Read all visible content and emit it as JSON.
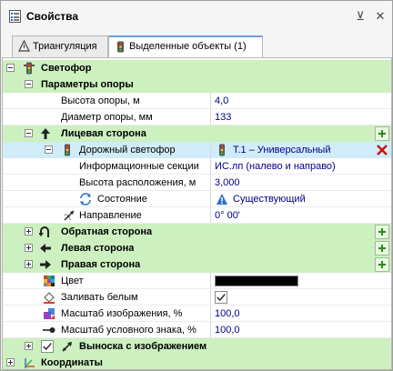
{
  "window": {
    "title": "Свойства",
    "pin_glyph": "⊻",
    "close_glyph": "✕"
  },
  "tabs": [
    {
      "label": "Триангуляция",
      "icon": "triangle-icon",
      "active": false
    },
    {
      "label": "Выделенные объекты (1)",
      "icon": "traffic-light-icon",
      "active": true
    }
  ],
  "grid": {
    "root": {
      "label": "Светофор"
    },
    "support_params": {
      "label": "Параметры опоры",
      "height_label": "Высота опоры, м",
      "height_value": "4,0",
      "diameter_label": "Диаметр опоры, мм",
      "diameter_value": "133"
    },
    "front_side": {
      "label": "Лицевая сторона",
      "road_light_label": "Дорожный светофор",
      "road_light_value": "Т.1 – Универсальный",
      "info_sections_label": "Информационные секции",
      "info_sections_value": "ИС.лп (налево и направо)",
      "placement_height_label": "Высота расположения, м",
      "placement_height_value": "3,000",
      "state_label": "Состояние",
      "state_value": "Существующий",
      "direction_label": "Направление",
      "direction_value": "0° 00'"
    },
    "back_side": {
      "label": "Обратная сторона"
    },
    "left_side": {
      "label": "Левая сторона"
    },
    "right_side": {
      "label": "Правая сторона"
    },
    "color": {
      "label": "Цвет",
      "value_hex": "#000000"
    },
    "fill_white": {
      "label": "Заливать белым",
      "checked": true
    },
    "image_scale": {
      "label": "Масштаб изображения, %",
      "value": "100,0"
    },
    "symbol_scale": {
      "label": "Масштаб условного знака, %",
      "value": "100,0"
    },
    "callout": {
      "label": "Выноска с изображением",
      "checked": true
    },
    "coordinates": {
      "label": "Координаты"
    }
  },
  "colors": {
    "category_bg": "#ccf0bf",
    "selected_bg": "#d0ecf8",
    "value_text": "#000080",
    "add_green": "#2c8a1f",
    "delete_red": "#d01010"
  }
}
